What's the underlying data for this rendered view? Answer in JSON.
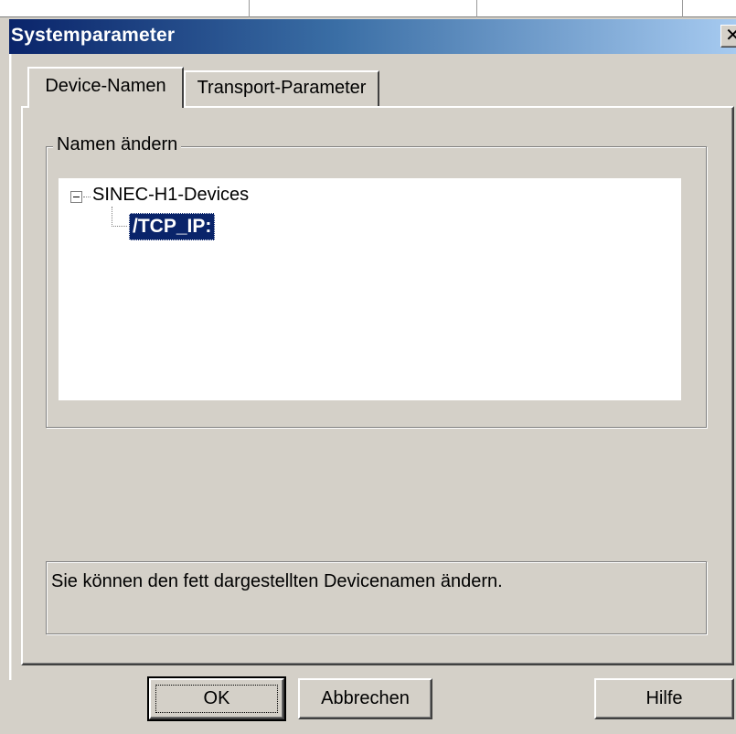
{
  "window": {
    "title": "Systemparameter",
    "close_glyph": "✕"
  },
  "tabs": [
    {
      "label": "Device-Namen",
      "active": true
    },
    {
      "label": "Transport-Parameter",
      "active": false
    }
  ],
  "group": {
    "legend": "Namen ändern"
  },
  "tree": {
    "root": {
      "label": "SINEC-H1-Devices",
      "expanded": true,
      "toggle_icon": "minus-box-icon"
    },
    "children": [
      {
        "label": "/TCP_IP:",
        "selected": true,
        "bold": true
      }
    ]
  },
  "info": {
    "text": "Sie können den fett dargestellten Devicenamen ändern."
  },
  "buttons": {
    "ok": "OK",
    "cancel": "Abbrechen",
    "help": "Hilfe"
  },
  "colors": {
    "dialog_face": "#d4d0c8",
    "title_active_start": "#0a246a",
    "title_active_end": "#a6caf0",
    "selection": "#0a246a"
  }
}
